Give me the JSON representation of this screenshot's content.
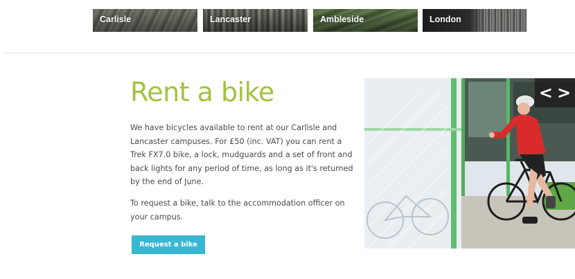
{
  "campus_tabs": [
    "Carlisle",
    "Lancaster",
    "Ambleside",
    "London"
  ],
  "rent_section": {
    "title": "Rent a bike",
    "paragraph_1": "We have bicycles available to rent at our Carlisle and Lancaster campuses. For £50 (inc. VAT) you can rent a Trek FX7.0 bike, a lock, mudguards and a set of front and back lights for any period of time, as long as it's returned by the end of June.",
    "paragraph_2": "To request a bike, talk to the accommodation officer on your campus.",
    "button_label": "Request a bike"
  },
  "slider": {
    "prev_symbol": "<",
    "next_symbol": ">"
  },
  "colors": {
    "title_green": "#a3c23e",
    "button_blue": "#38b7d2",
    "text_gray": "#4a4a4a"
  }
}
